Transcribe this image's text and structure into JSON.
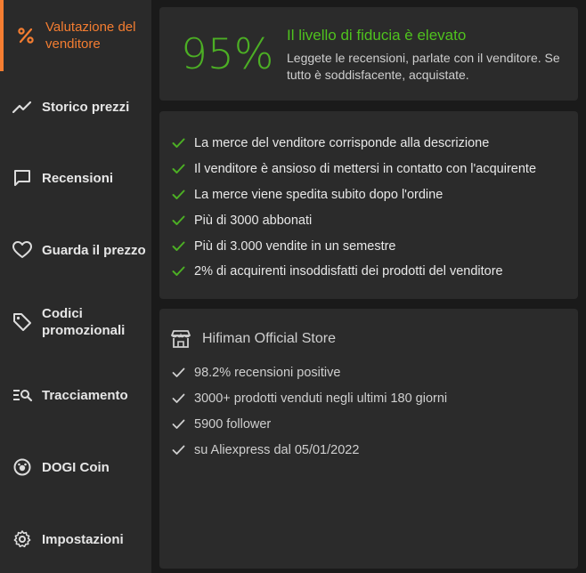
{
  "sidebar": {
    "items": [
      {
        "label": "Valutazione del venditore",
        "icon": "percent-icon",
        "active": true
      },
      {
        "label": "Storico prezzi",
        "icon": "trend-line-icon"
      },
      {
        "label": "Recensioni",
        "icon": "chat-bubble-icon"
      },
      {
        "label": "Guarda il prezzo",
        "icon": "heart-icon"
      },
      {
        "label": "Codici promozionali",
        "icon": "tag-icon"
      },
      {
        "label": "Tracciamento",
        "icon": "tracking-search-icon"
      },
      {
        "label": "DOGI Coin",
        "icon": "coin-icon"
      },
      {
        "label": "Impostazioni",
        "icon": "gear-icon"
      }
    ]
  },
  "trust": {
    "score": "95%",
    "title": "Il livello di fiducia è elevato",
    "description": "Leggete le recensioni, parlate con il venditore. Se tutto è soddisfacente, acquistate."
  },
  "checks": [
    "La merce del venditore corrisponde alla descrizione",
    "Il venditore è ansioso di mettersi in contatto con l'acquirente",
    "La merce viene spedita subito dopo l'ordine",
    "Più di 3000 abbonati",
    "Più di 3.000 vendite in un semestre",
    "2% di acquirenti insoddisfatti dei prodotti del venditore"
  ],
  "store": {
    "name": "Hifiman Official Store",
    "facts": [
      "98.2% recensioni positive",
      "3000+ prodotti venduti negli ultimi 180 giorni",
      "5900 follower",
      "su Aliexpress dal 05/01/2022"
    ]
  },
  "colors": {
    "accent": "#f47d31",
    "success": "#4caf24",
    "panel": "#2b2b2b",
    "sidebar": "#2a2a2a",
    "background": "#1a1a1a"
  }
}
